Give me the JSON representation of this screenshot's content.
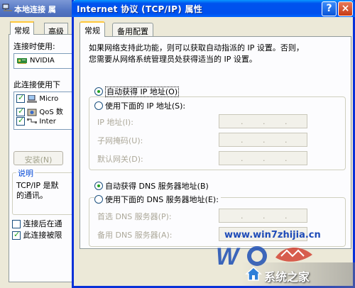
{
  "back_window": {
    "title": "本地连接 属",
    "tabs": [
      "常规",
      "高级"
    ],
    "connect_using_label": "连接时使用:",
    "adapter_name": "NVIDIA",
    "items_label": "此连接使用下",
    "items": [
      {
        "label": "Micro",
        "checked": true
      },
      {
        "label": "QoS 数",
        "checked": true
      },
      {
        "label": "Inter",
        "checked": true
      }
    ],
    "install_button": "安装(N)",
    "description_group": "说明",
    "description_text_1": "TCP/IP 是默",
    "description_text_2": "的通讯。",
    "option_show_icon": "连接后在通",
    "option_notify": "此连接被限",
    "option_show_icon_checked": false,
    "option_notify_checked": true
  },
  "dialog": {
    "title": "Internet 协议 (TCP/IP) 属性",
    "help_button": "?",
    "close_button": "×",
    "tabs": [
      "常规",
      "备用配置"
    ],
    "description_line1": "如果网络支持此功能，则可以获取自动指派的 IP 设置。否则，",
    "description_line2": "您需要从网络系统管理员处获得适当的 IP 设置。",
    "ip": {
      "auto_label": "自动获得 IP 地址(O)",
      "manual_label": "使用下面的 IP 地址(S):",
      "auto_selected": true,
      "fields": [
        {
          "label": "IP 地址(I):"
        },
        {
          "label": "子网掩码(U):"
        },
        {
          "label": "默认网关(D):"
        }
      ]
    },
    "dns": {
      "auto_label": "自动获得 DNS 服务器地址(B)",
      "manual_label": "使用下面的 DNS 服务器地址(E):",
      "auto_selected": true,
      "fields": [
        {
          "label": "首选 DNS 服务器(P):"
        },
        {
          "label": "备用 DNS 服务器(A):"
        }
      ]
    }
  },
  "watermark": {
    "url": "www.win7zhijia.cn",
    "brand": "系统之家"
  }
}
